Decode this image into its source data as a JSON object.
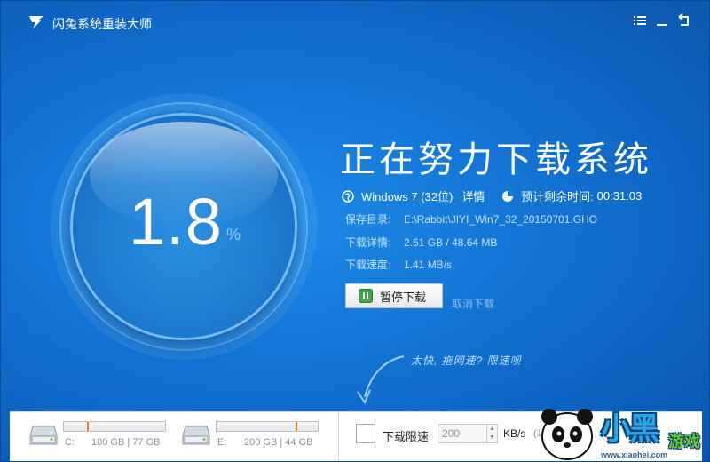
{
  "window": {
    "title": "闪兔系统重装大师"
  },
  "progress": {
    "value": "1.8",
    "unit": "%",
    "fraction": 0.018
  },
  "headline": "正在努力下载系统",
  "os": {
    "name": "Windows 7 (32位)",
    "detail_link": "详情"
  },
  "eta": {
    "label": "预计剩余时间:",
    "value": "00:31:03"
  },
  "meta": {
    "save_dir_label": "保存目录:",
    "save_dir_value": "E:\\Rabbit\\JIYI_Win7_32_20150701.GHO",
    "detail_label": "下载详情:",
    "detail_value": "2.61 GB / 48.64 MB",
    "speed_label": "下载速度:",
    "speed_value": "1.41 MB/s"
  },
  "actions": {
    "pause_label": "暂停下载",
    "cancel_label": "取消下载"
  },
  "hint": "太快, 拖网速? 限速呗",
  "disks": [
    {
      "drive": "C:",
      "usage": "100 GB | 77 GB",
      "used_fraction": 0.23
    },
    {
      "drive": "E:",
      "usage": "200 GB | 44 GB",
      "used_fraction": 0.78
    }
  ],
  "limit": {
    "label": "下载限速",
    "value": "200",
    "unit": "KB/s",
    "extra": "(1"
  },
  "watermark": {
    "text": "小黑",
    "text2": "游戏",
    "url": "www.xiaohei.com"
  },
  "colors": {
    "accent": "#1478d8",
    "orange": "#f27b1c",
    "white": "#ffffff"
  }
}
